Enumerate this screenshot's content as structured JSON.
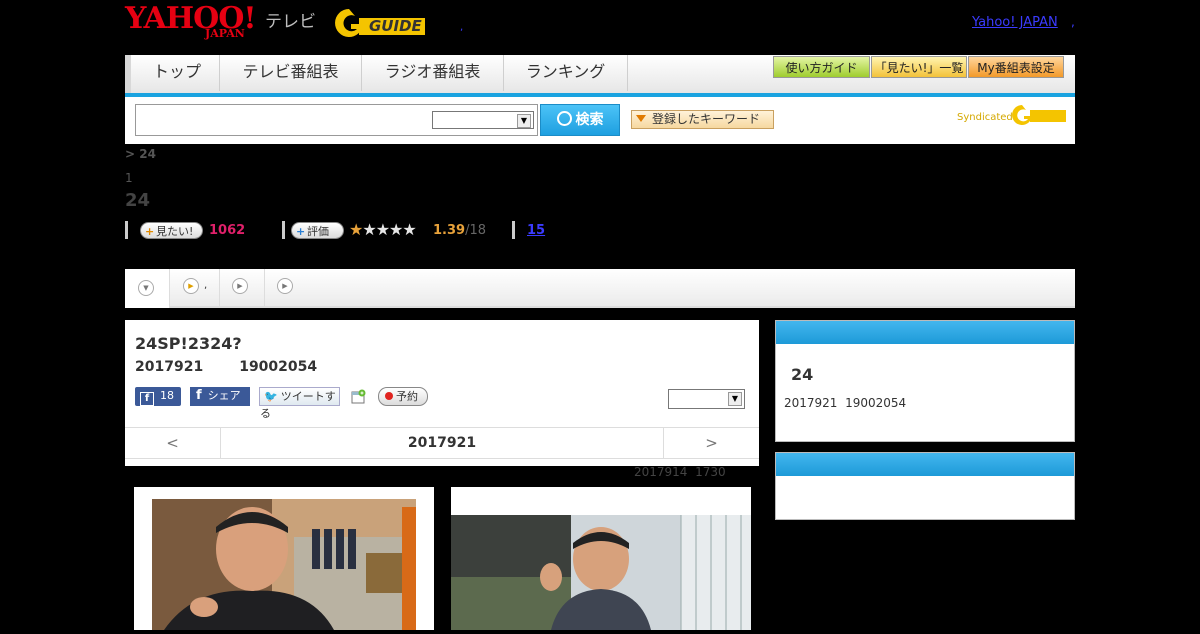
{
  "header": {
    "yahoo_logo": "YAHOO!",
    "yahoo_japan": "JAPAN",
    "tv_label": "テレビ",
    "gguide_logo": "GUIDE",
    "dot_a": ",",
    "top_link": "Yahoo! JAPAN",
    "dot_b": ","
  },
  "nav": {
    "tabs": [
      "トップ",
      "テレビ番組表",
      "ラジオ番組表",
      "ランキング"
    ],
    "right_buttons": [
      "使い方ガイド",
      "「見たい!」一覧",
      "My番組表設定"
    ]
  },
  "search": {
    "input_value": "",
    "select_value": "",
    "search_button": "検索",
    "keyword_button": "登録したキーワード",
    "syndicated": "Syndicated"
  },
  "program": {
    "breadcrumb": "> 24",
    "index": "1",
    "title": "24",
    "want_label": "見たい!",
    "want_count": "1062",
    "rate_label": "評価",
    "rating_stars": 1.39,
    "rating_value": "1.39",
    "rating_total": "/18",
    "reviews_link": "15"
  },
  "tabs": {
    "items": [
      "",
      ",",
      "",
      ""
    ]
  },
  "episode": {
    "title": "24SP!2324?",
    "date": "2017921",
    "time": "19002054",
    "fb_count": "18",
    "share_label": "シェア",
    "tweet_label": "ツイートする",
    "reserve_label": "予約",
    "select_value": "",
    "nav_prev": "<",
    "nav_date": "2017921",
    "nav_next": ">",
    "prev_broadcast_date": "2017914",
    "prev_broadcast_time": "1730"
  },
  "side": {
    "title": "24",
    "date": "2017921",
    "time": "19002054"
  },
  "colors": {
    "accent_blue": "#1aa3e0",
    "brand_red": "#e60012",
    "want_pink": "#e0206a",
    "rating_orange": "#e8a23a"
  }
}
